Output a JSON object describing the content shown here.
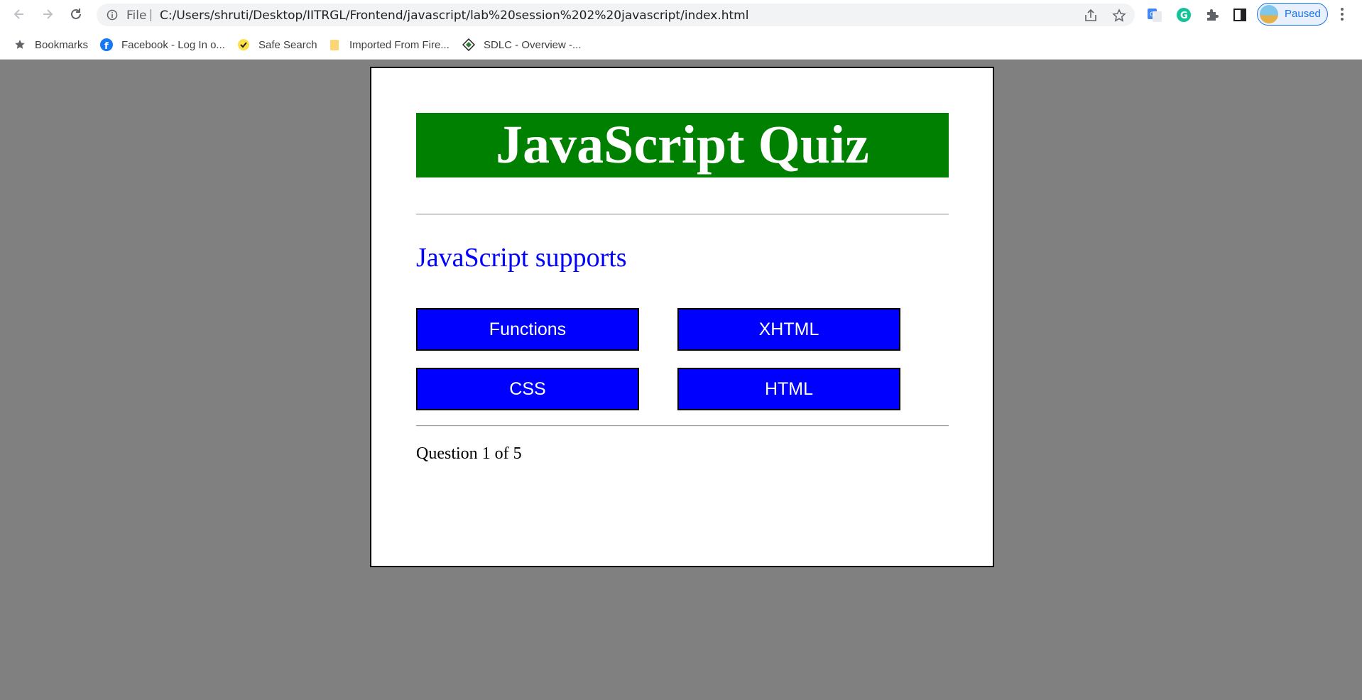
{
  "browser": {
    "url_scheme_label": "File",
    "url": "C:/Users/shruti/Desktop/IITRGL/Frontend/javascript/lab%20session%202%20javascript/index.html",
    "profile_label": "Paused",
    "bookmarks": [
      {
        "label": "Bookmarks",
        "icon": "star-icon"
      },
      {
        "label": "Facebook - Log In o...",
        "icon": "facebook-icon"
      },
      {
        "label": "Safe Search",
        "icon": "safe-search-icon"
      },
      {
        "label": "Imported From Fire...",
        "icon": "folder-icon"
      },
      {
        "label": "SDLC - Overview -...",
        "icon": "sdlc-icon"
      }
    ]
  },
  "quiz": {
    "title": "JavaScript Quiz",
    "question": "JavaScript supports",
    "choices": [
      "Functions",
      "XHTML",
      "CSS",
      "HTML"
    ],
    "progress": "Question 1 of 5",
    "colors": {
      "header_bg": "#008000",
      "question_text": "#0000ff",
      "choice_bg": "#0000ff",
      "page_bg": "#808080"
    }
  }
}
